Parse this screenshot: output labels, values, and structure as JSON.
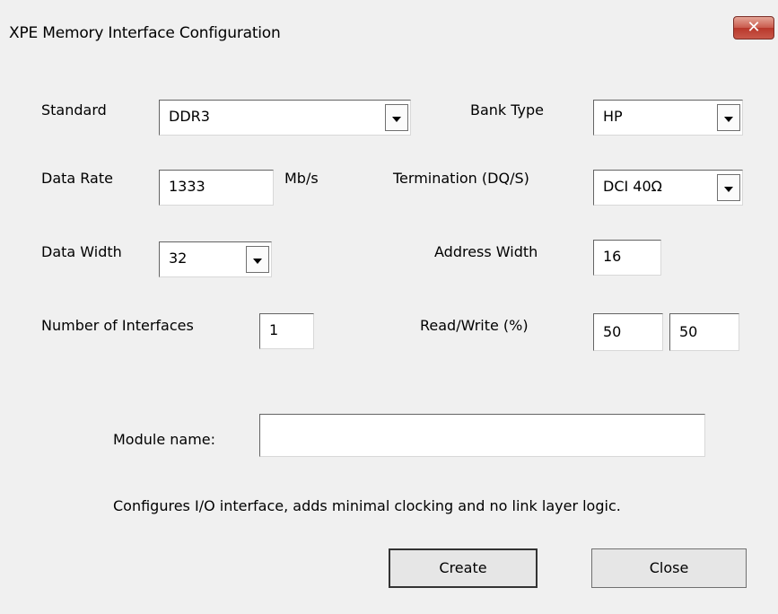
{
  "window": {
    "title": "XPE Memory Interface Configuration",
    "close_glyph": "✕"
  },
  "fields": {
    "standard": {
      "label": "Standard",
      "value": "DDR3"
    },
    "bank_type": {
      "label": "Bank Type",
      "value": "HP"
    },
    "data_rate": {
      "label": "Data Rate",
      "value": "1333",
      "unit": "Mb/s"
    },
    "termination": {
      "label": "Termination (DQ/S)",
      "value": "DCI 40Ω"
    },
    "data_width": {
      "label": "Data Width",
      "value": "32"
    },
    "address_width": {
      "label": "Address Width",
      "value": "16"
    },
    "num_interfaces": {
      "label": "Number of Interfaces",
      "value": "1"
    },
    "read_write": {
      "label": "Read/Write (%)",
      "read": "50",
      "write": "50"
    },
    "module_name": {
      "label": "Module name:",
      "value": ""
    }
  },
  "hint": "Configures I/O interface, adds minimal clocking and no link layer logic.",
  "buttons": {
    "create": "Create",
    "close": "Close"
  },
  "icons": {
    "dropdown": "chevron-down-icon",
    "close": "close-icon"
  }
}
